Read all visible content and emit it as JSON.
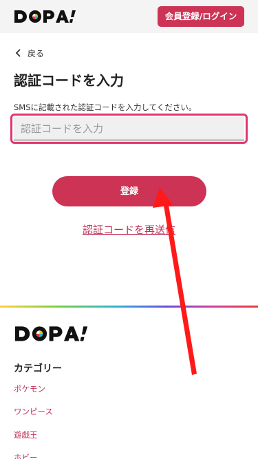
{
  "header": {
    "logo_text": "DOPA!",
    "auth_button": "会員登録/ログイン"
  },
  "back_link": {
    "label": "戻る",
    "icon": "chevron-left-icon"
  },
  "title": "認証コードを入力",
  "description": "SMSに記載された認証コードを入力してください。",
  "code_input": {
    "placeholder": "認証コードを入力",
    "value": ""
  },
  "submit_button": "登録",
  "resend_link": "認証コードを再送信",
  "footer": {
    "logo_text": "DOPA!",
    "category_title": "カテゴリー",
    "categories": [
      "ポケモン",
      "ワンピース",
      "遊戯王",
      "ホビー"
    ]
  },
  "colors": {
    "accent": "#cc3355",
    "highlight_border": "#e0366b",
    "annotation_arrow": "#ff0000"
  }
}
